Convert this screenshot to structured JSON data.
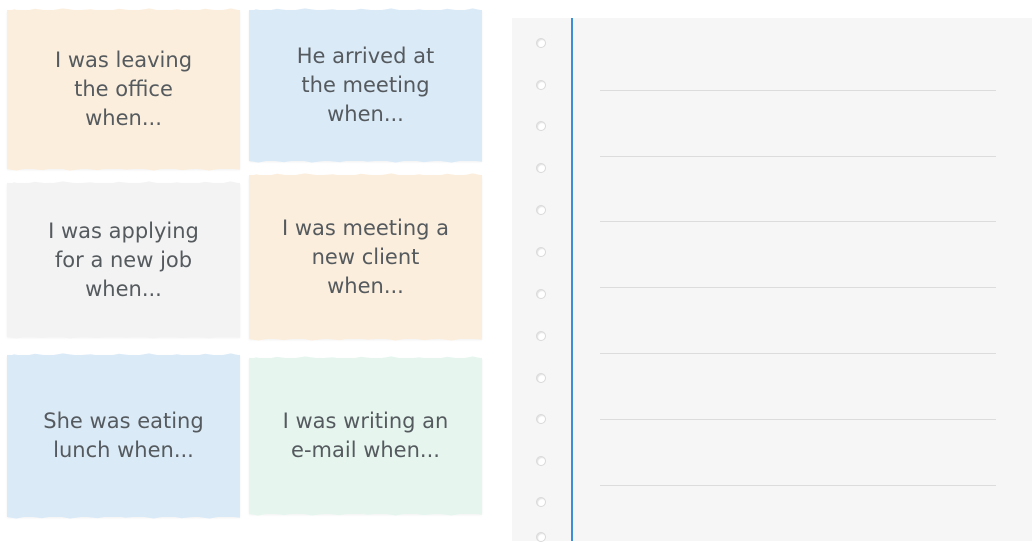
{
  "cards": [
    {
      "text": "I was leaving\nthe office\nwhen...",
      "color": "#fbeedd"
    },
    {
      "text": "He arrived at\nthe meeting\nwhen...",
      "color": "#dbeaf7"
    },
    {
      "text": "I was applying\nfor a new job\nwhen...",
      "color": "#f3f3f3"
    },
    {
      "text": "I was meeting a\nnew client\nwhen...",
      "color": "#fbeedd"
    },
    {
      "text": "She was eating\nlunch when...",
      "color": "#dbeaf7"
    },
    {
      "text": "I was writing an\ne-mail when...",
      "color": "#e6f6ef"
    }
  ],
  "notebook": {
    "background": "#f6f6f6",
    "margin_line_color": "#3d8ed8",
    "rule_count": 7,
    "hole_count": 13
  }
}
